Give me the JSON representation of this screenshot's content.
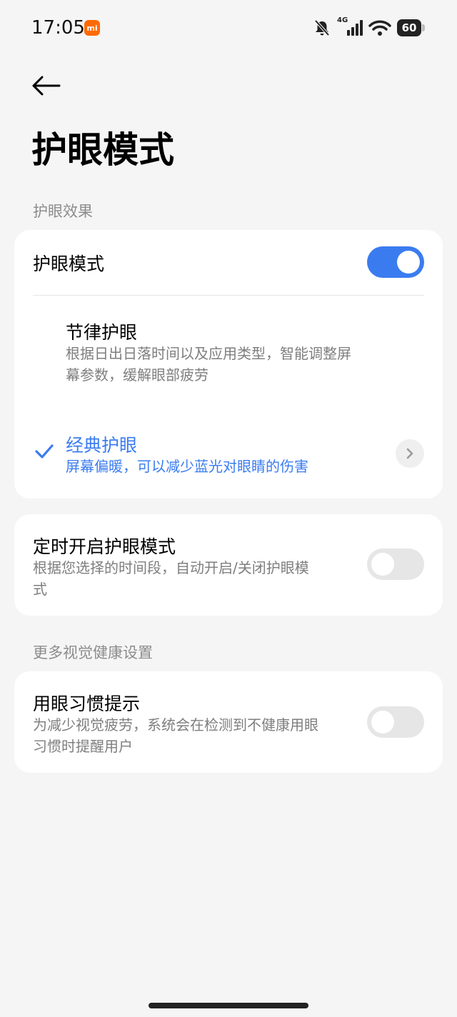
{
  "status_bar": {
    "time": "17:05",
    "brand_badge": "mi",
    "network": "4G",
    "battery": "60",
    "icons": [
      "bell-off-icon",
      "signal-icon",
      "wifi-icon",
      "battery-icon"
    ]
  },
  "page": {
    "title": "护眼模式"
  },
  "section_effect": {
    "label": "护眼效果",
    "eye_mode": {
      "label": "护眼模式",
      "enabled": true
    },
    "options": [
      {
        "title": "节律护眼",
        "description_line1": "根据日出日落时间以及应用类型，智能调整屏",
        "description_line2": "幕参数，缓解眼部疲劳",
        "selected": false
      },
      {
        "title": "经典护眼",
        "description": "屏幕偏暖，可以减少蓝光对眼睛的伤害",
        "selected": true
      }
    ]
  },
  "schedule": {
    "title": "定时开启护眼模式",
    "description_line1": "根据您选择的时间段，自动开启/关闭护眼模",
    "description_line2": "式",
    "enabled": false
  },
  "section_more": {
    "label": "更多视觉健康设置",
    "habit_reminder": {
      "title": "用眼习惯提示",
      "description_line1": "为减少视觉疲劳，系统会在检测到不健康用眼",
      "description_line2": "习惯时提醒用户",
      "enabled": false
    }
  },
  "colors": {
    "accent": "#3a7cf0",
    "background": "#f5f5f5",
    "card": "#ffffff",
    "brand": "#ff6a00"
  }
}
